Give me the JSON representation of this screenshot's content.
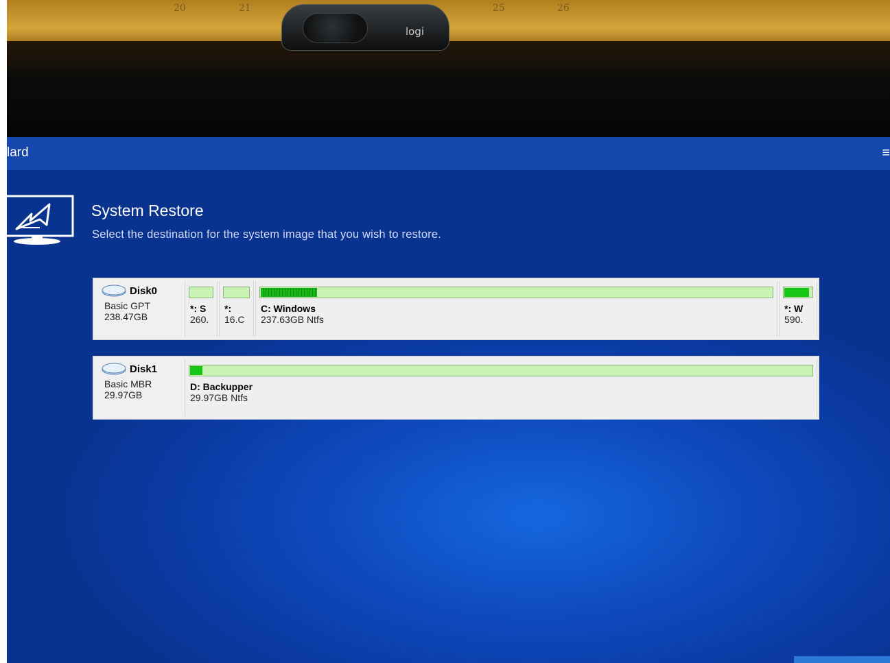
{
  "photo": {
    "calendar_numbers": [
      "20",
      "21",
      "25",
      "26"
    ],
    "webcam_brand": "logi"
  },
  "window": {
    "title": "lard",
    "menu_glyph": "≡"
  },
  "header": {
    "icon": "system-restore-icon",
    "title": "System Restore",
    "subtitle": "Select the destination for the system image that you wish to restore."
  },
  "disks": [
    {
      "name": "Disk0",
      "type": "Basic GPT",
      "size": "238.47GB",
      "partitions": [
        {
          "label": "*: S",
          "info": "260.",
          "used_fraction": 0.0
        },
        {
          "label": "*:",
          "info": "16.C",
          "used_fraction": 0.0
        },
        {
          "label": "C: Windows",
          "info": "237.63GB Ntfs",
          "used_fraction": 0.11
        },
        {
          "label": "*: W",
          "info": "590.",
          "used_fraction": 0.85
        }
      ]
    },
    {
      "name": "Disk1",
      "type": "Basic MBR",
      "size": "29.97GB",
      "partitions": [
        {
          "label": "D: Backupper",
          "info": "29.97GB Ntfs",
          "used_fraction": 0.02
        }
      ]
    }
  ],
  "colors": {
    "screen_blue": "#0f4cc0",
    "titlebar_blue": "#1547ad",
    "bar_free": "#c9f2b4",
    "bar_used": "#16c716"
  }
}
